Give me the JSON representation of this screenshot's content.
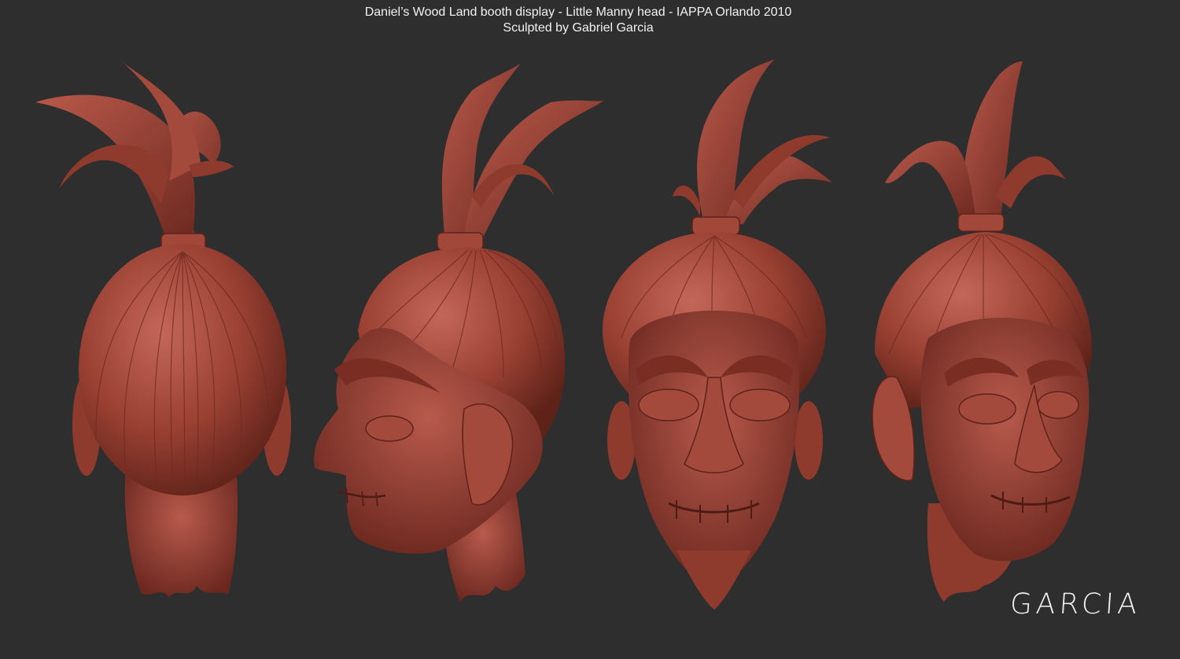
{
  "caption": {
    "line1": "Daniel’s Wood Land booth display - Little Manny head - IAPPA Orlando 2010",
    "line2": "Sculpted by Gabriel Garcia"
  },
  "signature": "GARCIA",
  "colors": {
    "background": "#2e2e2e",
    "clay": "#9a4133",
    "clay_dark": "#5e2219",
    "clay_light": "#c4675a",
    "text": "#f2f2f2"
  },
  "views": [
    {
      "id": "back",
      "icon": "head-back-view"
    },
    {
      "id": "left-profile",
      "icon": "head-profile-view"
    },
    {
      "id": "front",
      "icon": "head-front-view"
    },
    {
      "id": "three-quarter",
      "icon": "head-three-quarter-view"
    }
  ]
}
